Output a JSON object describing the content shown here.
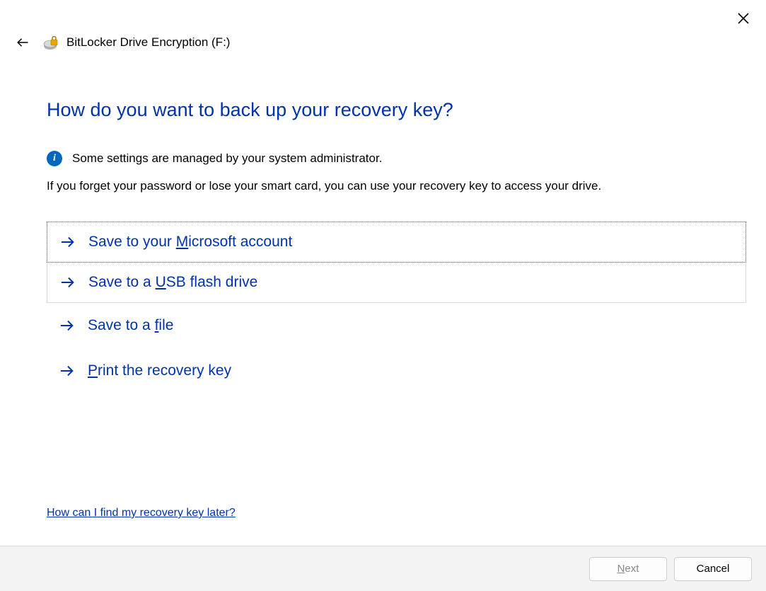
{
  "window": {
    "title": "BitLocker Drive Encryption (F:)"
  },
  "heading": "How do you want to back up your recovery key?",
  "info_notice": "Some settings are managed by your system administrator.",
  "description": "If you forget your password or lose your smart card, you can use your recovery key to access your drive.",
  "options": {
    "ms_account": {
      "pre": "Save to your ",
      "m": "M",
      "post": "icrosoft account"
    },
    "usb": {
      "pre": "Save to a ",
      "m": "U",
      "post": "SB flash drive"
    },
    "file": {
      "pre": "Save to a ",
      "m": "f",
      "post": "ile"
    },
    "print": {
      "pre": "",
      "m": "P",
      "post": "rint the recovery key"
    }
  },
  "help_link": "How can I find my recovery key later?",
  "footer": {
    "next": {
      "pre": "",
      "m": "N",
      "post": "ext"
    },
    "cancel": "Cancel"
  }
}
